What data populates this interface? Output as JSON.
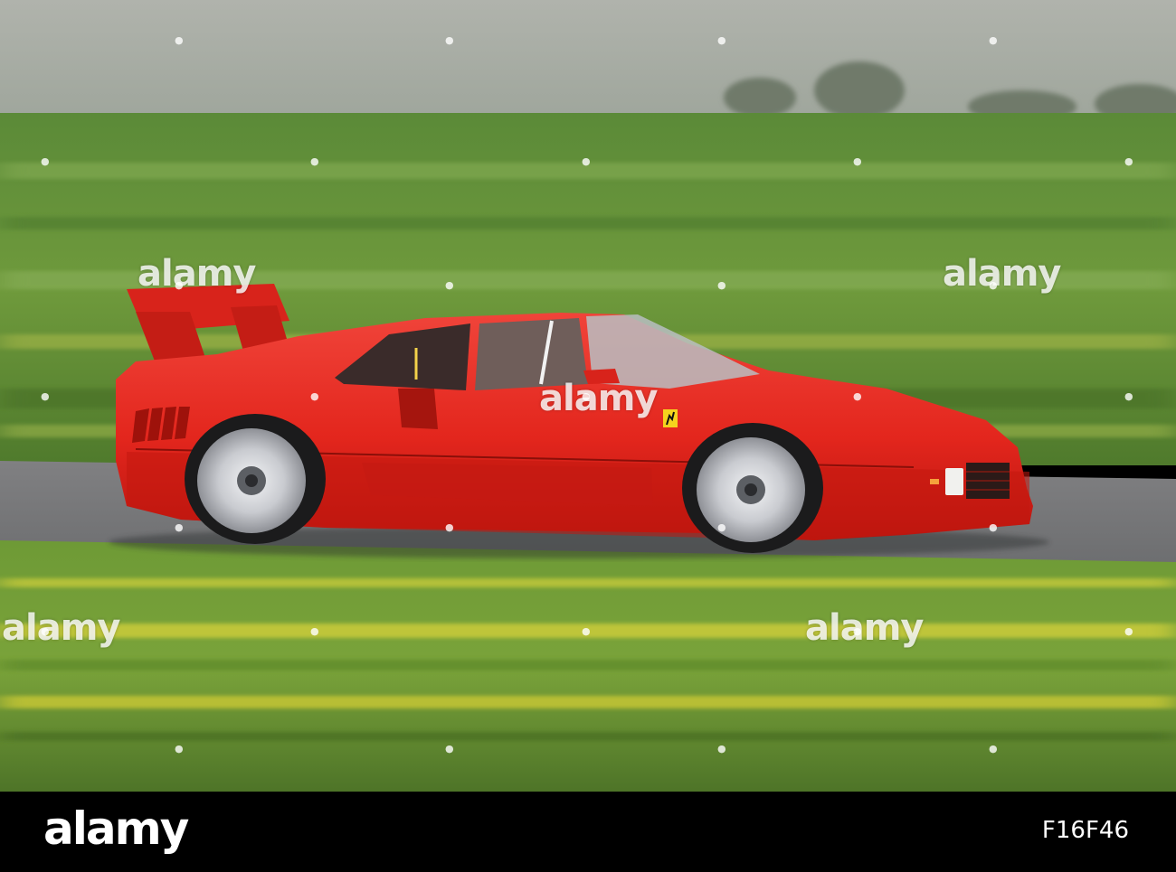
{
  "watermark": {
    "text": "alamy"
  },
  "footer": {
    "logo": "alamy",
    "image_id": "F16F46"
  },
  "colors": {
    "car_body": "#e8251e",
    "grass": "#5e8a2e",
    "sky": "#a9aea7",
    "road": "#77777a",
    "flowers": "#d9d22a"
  }
}
